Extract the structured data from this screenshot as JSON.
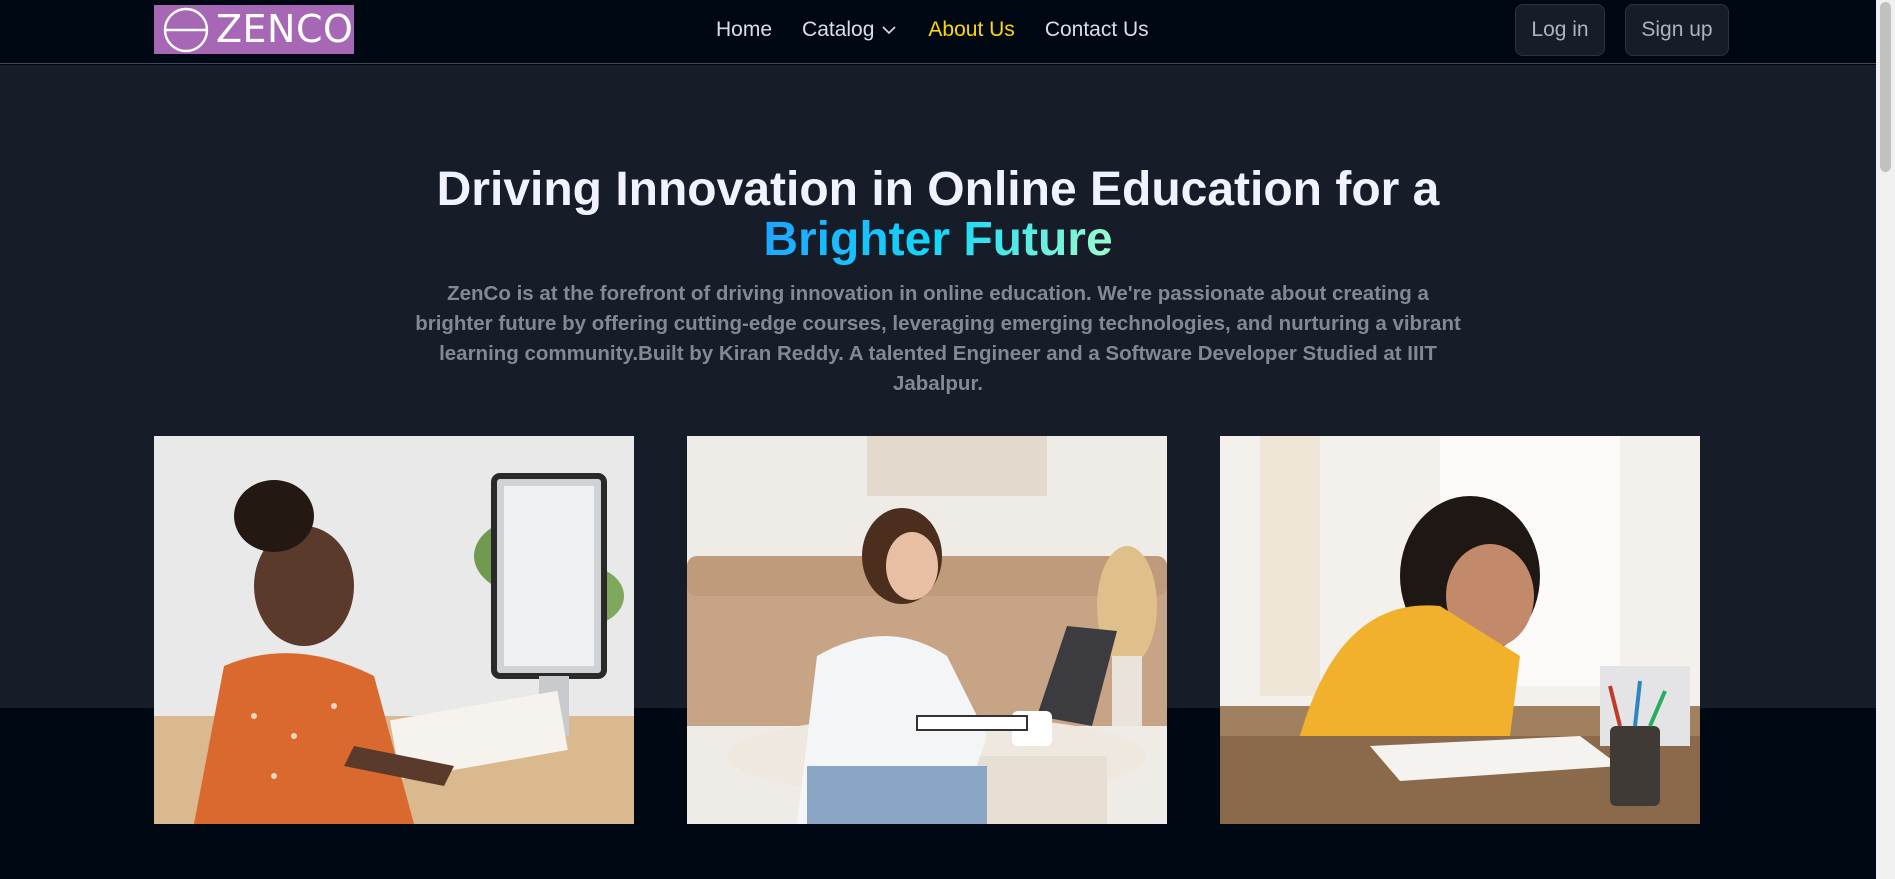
{
  "brand": {
    "name": "ZENCO",
    "logo_color": "#a668b4"
  },
  "nav": {
    "links": [
      {
        "label": "Home"
      },
      {
        "label": "Catalog"
      },
      {
        "label": "About Us"
      },
      {
        "label": "Contact Us"
      }
    ],
    "active": "About Us",
    "active_color": "#ffd60a"
  },
  "auth": {
    "login_label": "Log in",
    "signup_label": "Sign up"
  },
  "hero": {
    "title_line1": "Driving Innovation in Online Education for a",
    "title_highlight": "Brighter Future",
    "description": "ZenCo is at the forefront of driving innovation in online education. We're passionate about creating a brighter future by offering cutting-edge courses, leveraging emerging technologies, and nurturing a vibrant learning community.Built by Kiran Reddy. A talented Engineer and a Software Developer Studied at IIIT Jabalpur."
  },
  "colors": {
    "page_bg": "#000814",
    "hero_bg": "#161d29",
    "heading": "#f1f2ff",
    "body_text": "#838894"
  },
  "icons": {
    "catalog_caret": "chevron-down-icon"
  }
}
